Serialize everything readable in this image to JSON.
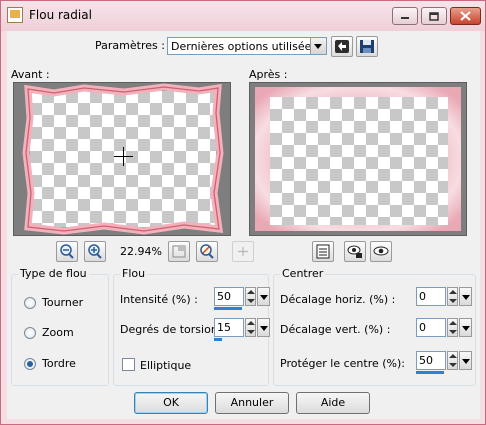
{
  "window": {
    "title": "Flou radial"
  },
  "colors": {
    "accent": "#2f7ed8",
    "frame_pink": "#f4dde3",
    "close_red": "#c7432e"
  },
  "toolbar": {
    "presets_label": "Paramètres :",
    "presets_value": "Dernières options utilisées",
    "reset_icon": "reset-arrow-icon",
    "save_icon": "floppy-disk-icon"
  },
  "previews": {
    "before_label": "Avant :",
    "after_label": "Après :"
  },
  "zoom": {
    "value": "22.94%"
  },
  "blur_type": {
    "title": "Type de flou",
    "options": [
      {
        "label": "Tourner",
        "selected": false
      },
      {
        "label": "Zoom",
        "selected": false
      },
      {
        "label": "Tordre",
        "selected": true
      }
    ]
  },
  "blur": {
    "title": "Flou",
    "intensity_label": "Intensité (%) :",
    "intensity_value": "50",
    "intensity_fraction": 0.5,
    "twist_label": "Degrés de torsion :",
    "twist_value": "15",
    "twist_fraction": 0.15,
    "elliptic_label": "Elliptique",
    "elliptic_checked": false
  },
  "center": {
    "title": "Centrer",
    "h_offset_label": "Décalage horiz. (%) :",
    "h_offset_value": "0",
    "v_offset_label": "Décalage vert. (%) :",
    "v_offset_value": "0",
    "protect_label": "Protéger le centre (%):",
    "protect_value": "50",
    "protect_fraction": 0.5
  },
  "buttons": {
    "ok": "OK",
    "cancel": "Annuler",
    "help": "Aide"
  }
}
